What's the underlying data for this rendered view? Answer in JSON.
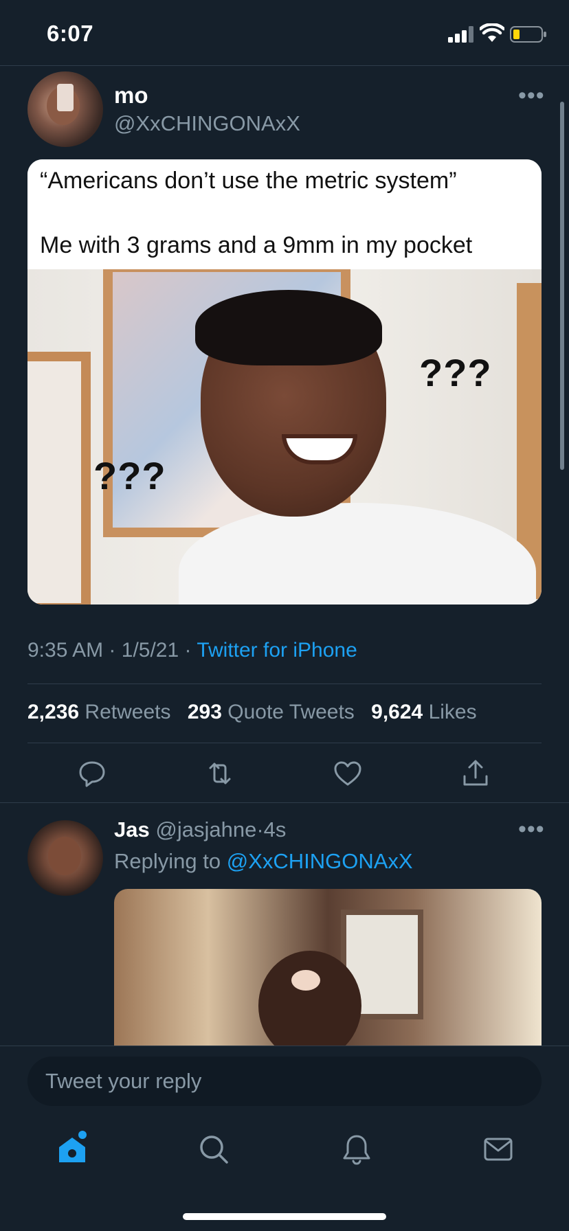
{
  "status_bar": {
    "time": "6:07",
    "signal_icon": "signal-bars-icon",
    "wifi_icon": "wifi-icon",
    "battery_icon": "battery-low-icon",
    "battery_color": "#ffd60a"
  },
  "tweet": {
    "display_name": "mo",
    "handle": "@XxCHINGONAxX",
    "more": "•••",
    "meme": {
      "caption_line1": "“Americans don’t use the metric system”",
      "caption_line2": "Me with 3 grams and a 9mm in my pocket",
      "qmarks_left": "???",
      "qmarks_right": "???"
    },
    "time": "9:35 AM",
    "date": "1/5/21",
    "separator": "·",
    "source": "Twitter for iPhone",
    "stats": {
      "retweets": "2,236",
      "retweets_label": "Retweets",
      "quotes": "293",
      "quotes_label": "Quote Tweets",
      "likes": "9,624",
      "likes_label": "Likes"
    },
    "actions": [
      "reply-icon",
      "retweet-icon",
      "like-icon",
      "share-icon"
    ]
  },
  "reply": {
    "display_name": "Jas",
    "handle": "@jasjahne",
    "separator": "·",
    "age": "4s",
    "replying_prefix": "Replying to",
    "replying_to": "@XxCHINGONAxX",
    "more": "•••"
  },
  "composer": {
    "placeholder": "Tweet your reply"
  },
  "tabs": [
    "home-icon",
    "search-icon",
    "notifications-icon",
    "messages-icon"
  ],
  "colors": {
    "background": "#15202b",
    "accent": "#1da1f2",
    "secondary_text": "#8899a6",
    "divider": "#2f3d4b"
  }
}
